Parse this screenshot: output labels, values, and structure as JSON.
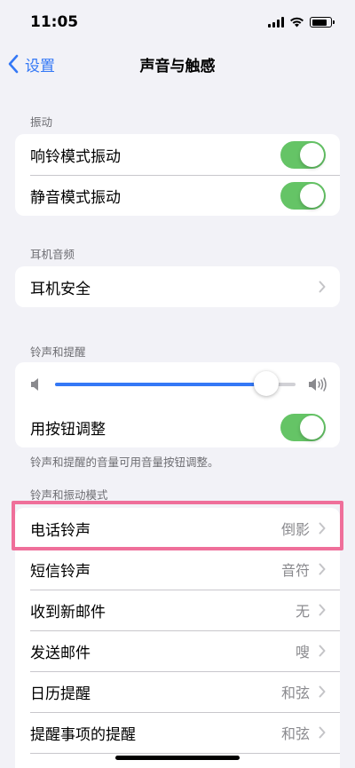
{
  "status_bar": {
    "time": "11:05"
  },
  "nav": {
    "back_label": "设置",
    "title": "声音与触感"
  },
  "vibration": {
    "header": "振动",
    "items": [
      {
        "label": "响铃模式振动",
        "on": true
      },
      {
        "label": "静音模式振动",
        "on": true
      }
    ]
  },
  "headphone": {
    "header": "耳机音频",
    "items": [
      {
        "label": "耳机安全"
      }
    ]
  },
  "ringer": {
    "header": "铃声和提醒",
    "volume": 0.88,
    "button_adjust_label": "用按钮调整",
    "button_adjust_on": true,
    "footer": "铃声和提醒的音量可用音量按钮调整。"
  },
  "patterns": {
    "header": "铃声和振动模式",
    "items": [
      {
        "label": "电话铃声",
        "value": "倒影"
      },
      {
        "label": "短信铃声",
        "value": "音符"
      },
      {
        "label": "收到新邮件",
        "value": "无"
      },
      {
        "label": "发送邮件",
        "value": "嗖"
      },
      {
        "label": "日历提醒",
        "value": "和弦"
      },
      {
        "label": "提醒事项的提醒",
        "value": "和弦"
      }
    ]
  },
  "colors": {
    "accent": "#3478f6",
    "toggle_on": "#65c466",
    "highlight": "#ef6f9a"
  }
}
